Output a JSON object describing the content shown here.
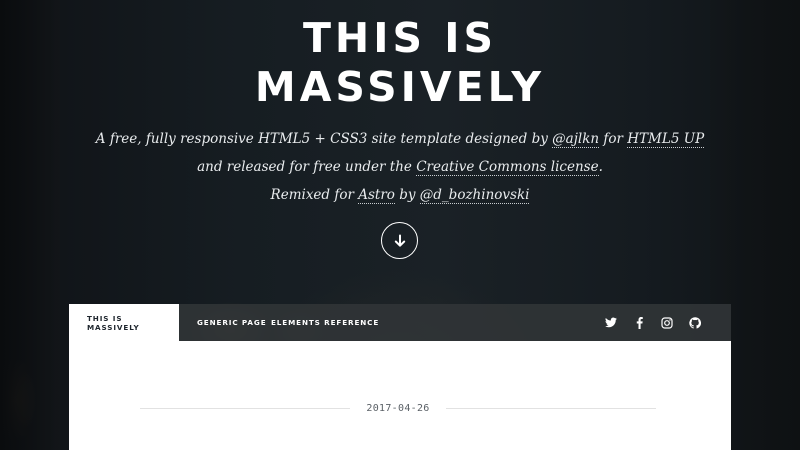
{
  "header": {
    "title_line1": "THIS IS",
    "title_line2": "MASSIVELY",
    "subtitle": {
      "line1_pre": "A free, fully responsive HTML5 + CSS3 site template designed by ",
      "line1_link1": "@ajlkn",
      "line1_mid": " for ",
      "line1_link2": "HTML5 UP",
      "line2_pre": "and released for free under the ",
      "line2_link": "Creative Commons license",
      "line2_post": ".",
      "line3_pre": "Remixed for ",
      "line3_link1": "Astro",
      "line3_mid": " by ",
      "line3_link2": "@d_bozhinovski"
    },
    "scroll_icon": "arrow-down-icon"
  },
  "nav": {
    "tabs": [
      {
        "label": "This is Massively",
        "active": true
      },
      {
        "label": "Generic Page",
        "active": false
      },
      {
        "label": "Elements Reference",
        "active": false
      }
    ],
    "social_icons": [
      "twitter-icon",
      "facebook-icon",
      "instagram-icon",
      "github-icon"
    ]
  },
  "main": {
    "date": "2017-04-26"
  },
  "colors": {
    "background": "#141a1f",
    "nav_bg": "#303436",
    "panel_bg": "#ffffff",
    "text_dark": "#1e252d"
  }
}
